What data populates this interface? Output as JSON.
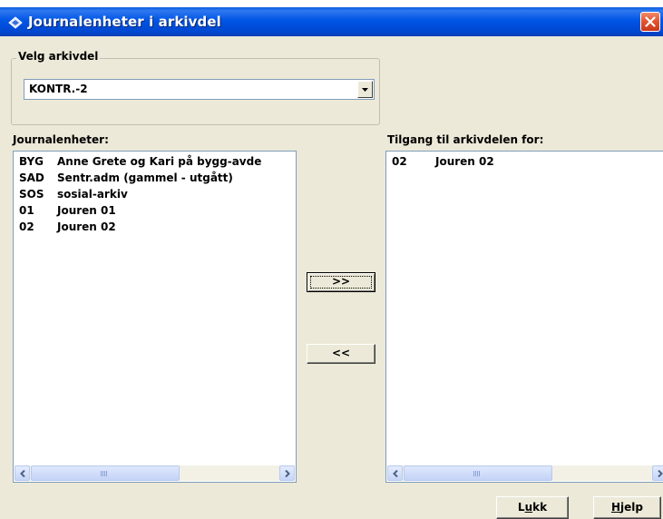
{
  "window": {
    "title": "Journalenheter i arkivdel"
  },
  "archive_group": {
    "legend": "Velg arkivdel",
    "selected": "KONTR.-2"
  },
  "left_list": {
    "label": "Journalenheter:",
    "items": [
      {
        "code": "BYG",
        "name": "Anne Grete og Kari på bygg-avde"
      },
      {
        "code": "SAD",
        "name": "Sentr.adm (gammel - utgått)"
      },
      {
        "code": "SOS",
        "name": "sosial-arkiv"
      },
      {
        "code": "01",
        "name": "Jouren 01"
      },
      {
        "code": "02",
        "name": "Jouren 02"
      }
    ]
  },
  "right_list": {
    "label": "Tilgang til arkivdelen for:",
    "items": [
      {
        "code": "02",
        "name": "Jouren 02"
      }
    ]
  },
  "buttons": {
    "add": ">>",
    "remove": "<<",
    "close_mnemonic": "L",
    "close_underlined": "u",
    "close_rest": "kk",
    "help_underlined": "H",
    "help_rest": "jelp"
  },
  "colors": {
    "titlebar": "#0055e5",
    "dialog_bg": "#ece9d8",
    "close_red": "#e2522c"
  },
  "icons": [
    "app-icon",
    "close-icon",
    "dropdown-arrow-icon",
    "scroll-left-icon",
    "scroll-right-icon"
  ]
}
